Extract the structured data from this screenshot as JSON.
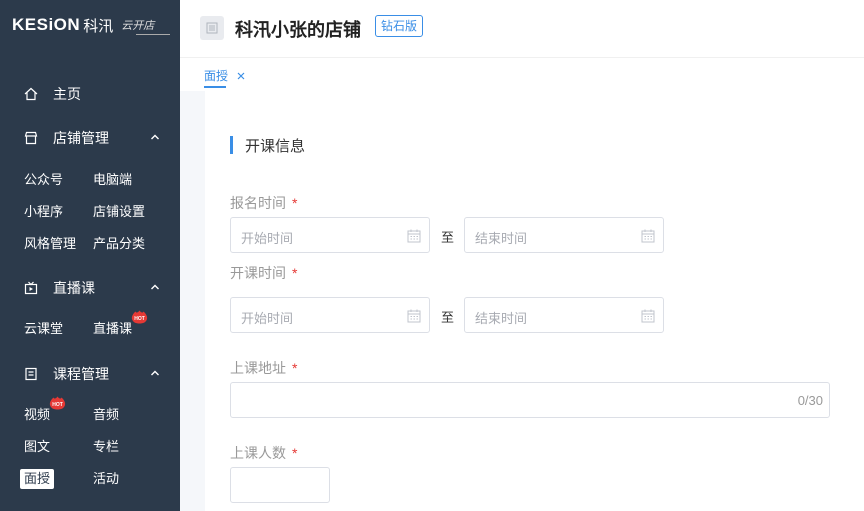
{
  "brand": {
    "logo_word": "KESiON",
    "logo_cn": "科汛",
    "logo_script": "云开店"
  },
  "header": {
    "store_name": "科汛小张的店铺",
    "edition": "钻石版"
  },
  "sidebar": {
    "home": "主页",
    "sections": [
      {
        "label": "店铺管理",
        "items": [
          "公众号",
          "电脑端",
          "小程序",
          "店铺设置",
          "风格管理",
          "产品分类"
        ]
      },
      {
        "label": "直播课",
        "items": [
          "云课堂",
          "直播课"
        ]
      },
      {
        "label": "课程管理",
        "items": [
          "视频",
          "音频",
          "图文",
          "专栏",
          "面授",
          "活动"
        ]
      }
    ],
    "hot_badge": "HOT",
    "active_item": "面授"
  },
  "tabs": [
    {
      "label": "面授",
      "active": true
    }
  ],
  "form": {
    "section_title": "开课信息",
    "signup_time": {
      "label": "报名时间",
      "start_placeholder": "开始时间",
      "end_placeholder": "结束时间"
    },
    "class_time": {
      "label": "开课时间",
      "start_placeholder": "开始时间",
      "end_placeholder": "结束时间"
    },
    "range_separator": "至",
    "address": {
      "label": "上课地址",
      "counter": "0/30"
    },
    "headcount": {
      "label": "上课人数"
    },
    "required_mark": "*"
  },
  "colors": {
    "sidebar_bg": "#2c3a4b",
    "accent": "#3a8ee6",
    "required": "#e53935",
    "hot": "#e53935"
  },
  "icons": [
    "home-icon",
    "store-icon",
    "live-icon",
    "course-icon",
    "chevron-up-icon",
    "calendar-icon",
    "close-icon",
    "shop-icon"
  ]
}
